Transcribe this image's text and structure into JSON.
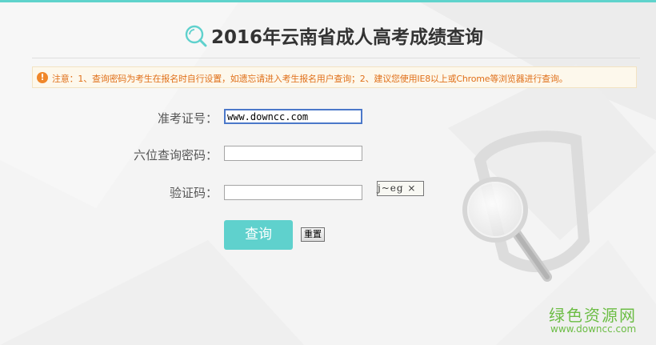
{
  "header": {
    "title": "2016年云南省成人高考成绩查询"
  },
  "notice": {
    "icon": "exclamation-icon",
    "text": "注意：1、查询密码为考生在报名时自行设置，如遗忘请进入考生报名用户查询；2、建议您使用IE8以上或Chrome等浏览器进行查询。"
  },
  "form": {
    "exam_no_label": "准考证号：",
    "exam_no_value": "www.downcc.com",
    "password_label": "六位查询密码：",
    "password_value": "",
    "captcha_label": "验证码：",
    "captcha_value": "",
    "captcha_image_text": "j~eg ×"
  },
  "buttons": {
    "query": "查询",
    "reset": "重置"
  },
  "watermark": {
    "title": "绿色资源网",
    "url": "www.downcc.com"
  },
  "colors": {
    "accent": "#5fd1cd",
    "notice_text": "#e0701a",
    "watermark": "#6cbd45"
  }
}
